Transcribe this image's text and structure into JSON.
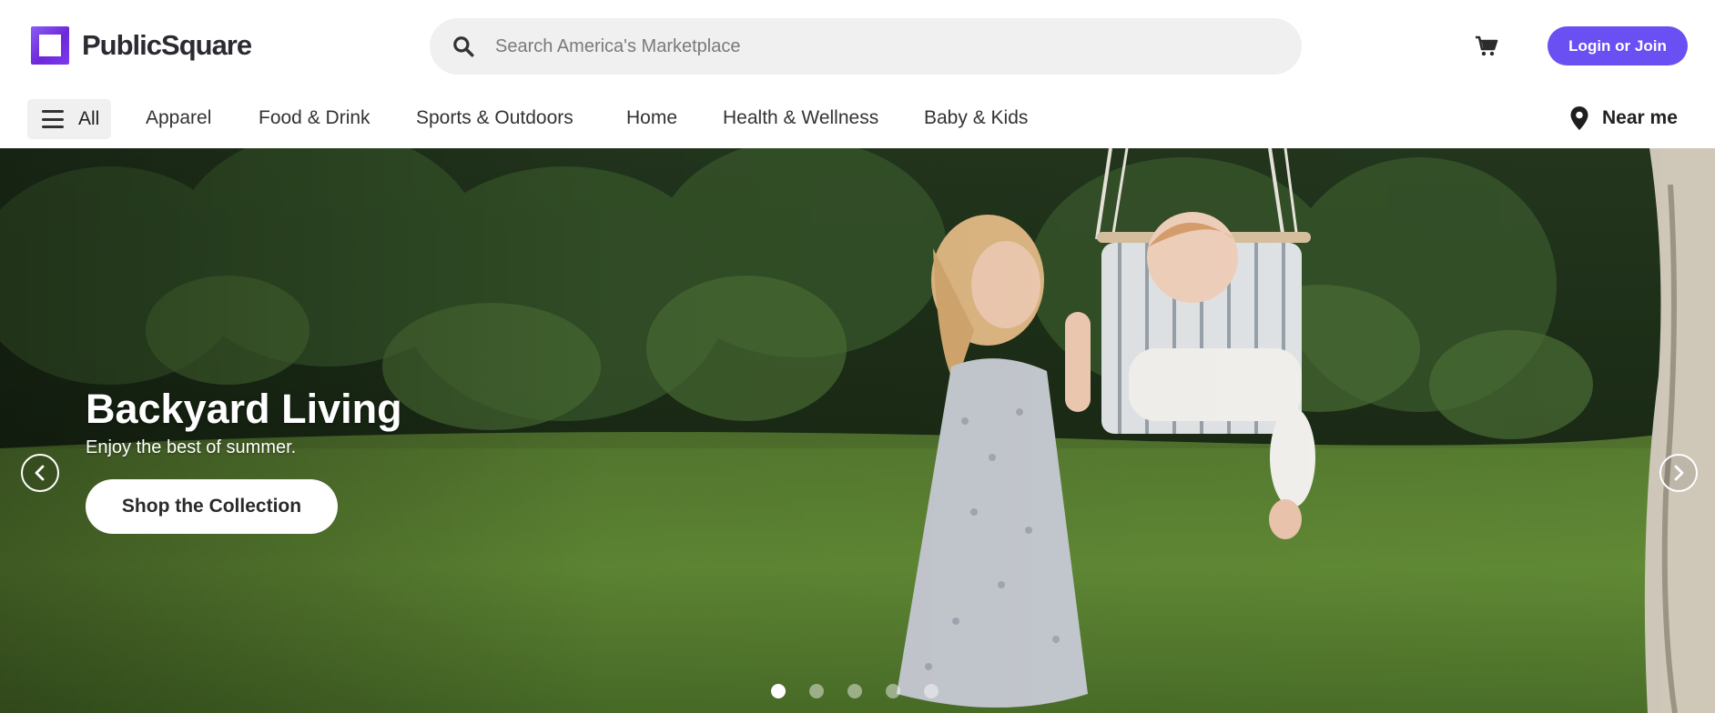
{
  "header": {
    "logo_text": "PublicSquare",
    "search_placeholder": "Search America's Marketplace",
    "login_label": "Login or Join"
  },
  "nav": {
    "all_label": "All",
    "categories": [
      "Apparel",
      "Food & Drink",
      "Sports & Outdoors",
      "Home",
      "Health & Wellness",
      "Baby & Kids"
    ],
    "near_me_label": "Near me"
  },
  "hero": {
    "title": "Backyard Living",
    "subtitle": "Enjoy the best of summer.",
    "cta_label": "Shop the Collection",
    "slide_count": 5,
    "active_slide": 1
  },
  "colors": {
    "brand_purple": "#6a4ff2",
    "logo_gradient_start": "#8b5cf6",
    "search_bg": "#f0f0f0"
  },
  "icons": [
    "logo-mark-icon",
    "search-icon",
    "cart-icon",
    "menu-icon",
    "location-pin-icon",
    "chevron-left-icon",
    "chevron-right-icon"
  ]
}
